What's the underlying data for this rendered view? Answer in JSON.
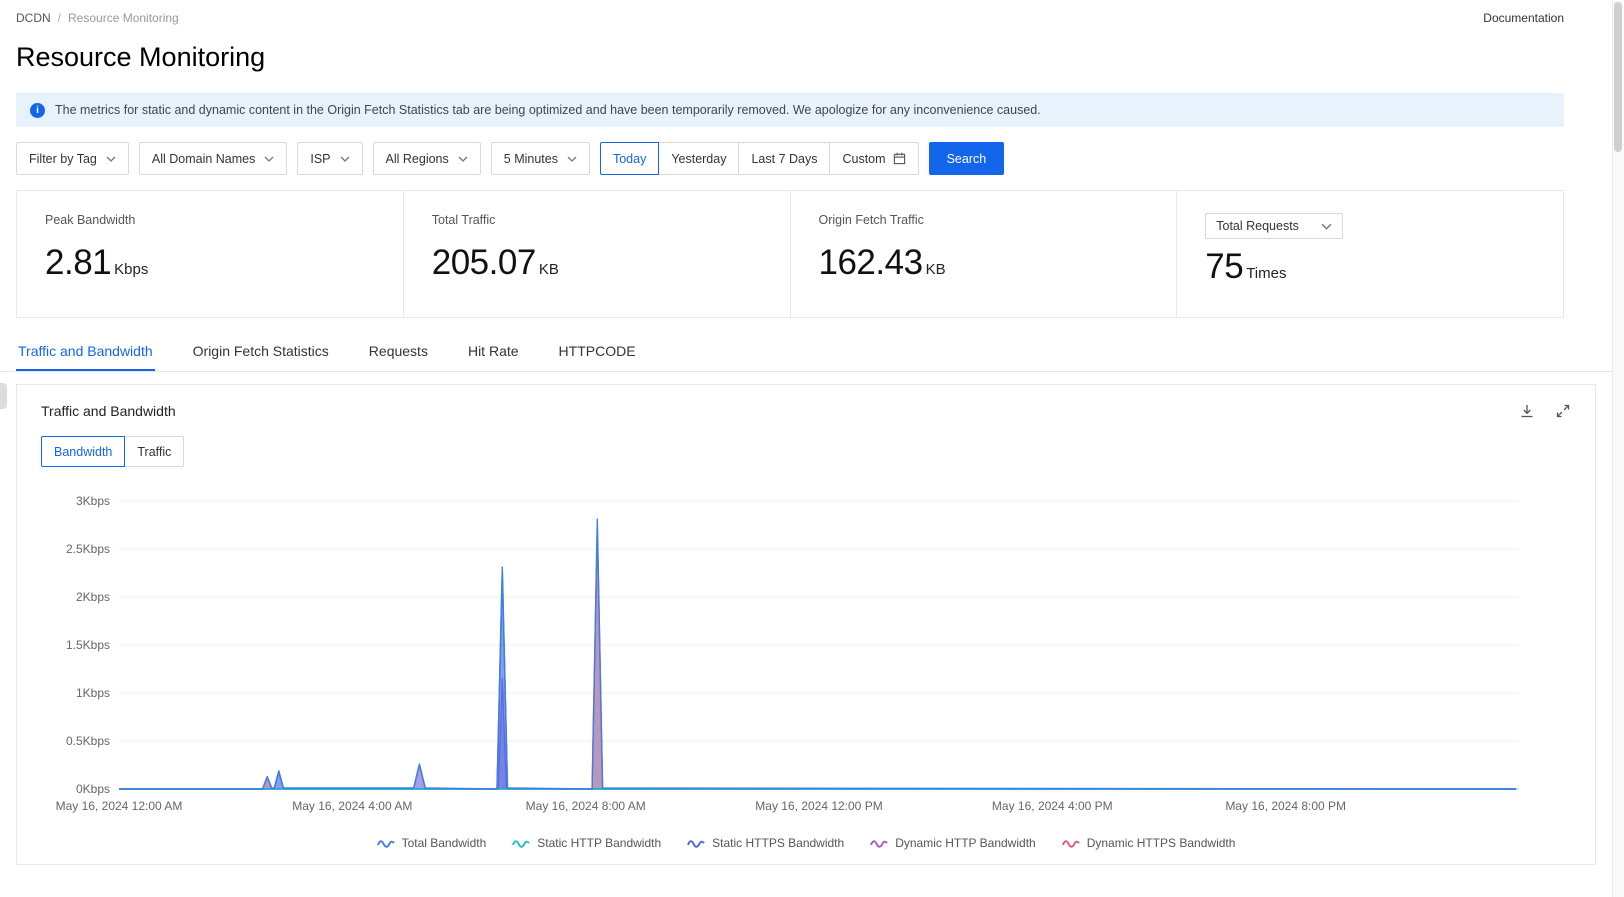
{
  "colors": {
    "accent": "#1366ec"
  },
  "breadcrumb": {
    "root": "DCDN",
    "separator": "/",
    "current": "Resource Monitoring"
  },
  "topbar": {
    "doc_link": "Documentation"
  },
  "page": {
    "title": "Resource Monitoring"
  },
  "banner": {
    "text": "The metrics for static and dynamic content in the Origin Fetch Statistics tab are being optimized and have been temporarily removed. We apologize for any inconvenience caused."
  },
  "filters": {
    "tag_label": "Filter by Tag",
    "domain_label": "All Domain Names",
    "isp_label": "ISP",
    "regions_label": "All Regions",
    "interval_label": "5 Minutes",
    "ranges": [
      "Today",
      "Yesterday",
      "Last 7 Days",
      "Custom"
    ],
    "active_range": "Today",
    "search_label": "Search"
  },
  "stats": [
    {
      "label": "Peak Bandwidth",
      "value": "2.81",
      "unit": "Kbps"
    },
    {
      "label": "Total Traffic",
      "value": "205.07",
      "unit": "KB"
    },
    {
      "label": "Origin Fetch Traffic",
      "value": "162.43",
      "unit": "KB"
    },
    {
      "label": "Total Requests",
      "value": "75",
      "unit": "Times"
    }
  ],
  "tabs": {
    "items": [
      "Traffic and Bandwidth",
      "Origin Fetch Statistics",
      "Requests",
      "Hit Rate",
      "HTTPCODE"
    ],
    "active": "Traffic and Bandwidth"
  },
  "chart_panel": {
    "title": "Traffic and Bandwidth",
    "toggles": [
      "Bandwidth",
      "Traffic"
    ],
    "active_toggle": "Bandwidth"
  },
  "chart_data": {
    "type": "area",
    "title": "Traffic and Bandwidth",
    "unit": "Kbps",
    "xlim_hours": [
      0,
      24
    ],
    "ylim_kbps": [
      0,
      3
    ],
    "grid": "horizontal",
    "legend_position": "bottom",
    "y_ticks": [
      {
        "v": 0,
        "label": "0Kbps"
      },
      {
        "v": 0.5,
        "label": "0.5Kbps"
      },
      {
        "v": 1,
        "label": "1Kbps"
      },
      {
        "v": 1.5,
        "label": "1.5Kbps"
      },
      {
        "v": 2,
        "label": "2Kbps"
      },
      {
        "v": 2.5,
        "label": "2.5Kbps"
      },
      {
        "v": 3,
        "label": "3Kbps"
      }
    ],
    "x_ticks": [
      {
        "h": 0,
        "label": "May 16, 2024 12:00 AM"
      },
      {
        "h": 4,
        "label": "May 16, 2024 4:00 AM"
      },
      {
        "h": 8,
        "label": "May 16, 2024 8:00 AM"
      },
      {
        "h": 12,
        "label": "May 16, 2024 12:00 PM"
      },
      {
        "h": 16,
        "label": "May 16, 2024 4:00 PM"
      },
      {
        "h": 20,
        "label": "May 16, 2024 8:00 PM"
      }
    ],
    "series": [
      {
        "name": "Total Bandwidth",
        "color": "#3D7FE4",
        "fill_opacity": 0.3,
        "points": [
          [
            0,
            0
          ],
          [
            2.46,
            0
          ],
          [
            2.54,
            0.13
          ],
          [
            2.62,
            0.01
          ],
          [
            2.66,
            0.01
          ],
          [
            2.74,
            0.19
          ],
          [
            2.82,
            0.01
          ],
          [
            5.05,
            0.01
          ],
          [
            5.15,
            0.26
          ],
          [
            5.25,
            0.01
          ],
          [
            6.48,
            0
          ],
          [
            6.57,
            2.31
          ],
          [
            6.66,
            0.01
          ],
          [
            8.11,
            0
          ],
          [
            8.2,
            2.81
          ],
          [
            8.29,
            0.01
          ],
          [
            23.95,
            0
          ]
        ]
      },
      {
        "name": "Static HTTP Bandwidth",
        "color": "#18C5C5",
        "fill_opacity": 0.5,
        "points": [
          [
            0,
            0
          ],
          [
            23.95,
            0
          ]
        ]
      },
      {
        "name": "Static HTTPS Bandwidth",
        "color": "#4C63E2",
        "fill_opacity": 0.5,
        "points": [
          [
            0,
            0
          ],
          [
            2.66,
            0
          ],
          [
            2.74,
            0.18
          ],
          [
            2.82,
            0
          ],
          [
            6.48,
            0
          ],
          [
            6.57,
            2.27
          ],
          [
            6.66,
            0
          ],
          [
            23.95,
            0
          ]
        ]
      },
      {
        "name": "Dynamic HTTP Bandwidth",
        "color": "#9C5FD8",
        "fill_opacity": 0.5,
        "points": [
          [
            0,
            0
          ],
          [
            5.05,
            0
          ],
          [
            5.15,
            0.25
          ],
          [
            5.25,
            0
          ],
          [
            6.5,
            0
          ],
          [
            6.57,
            1.15
          ],
          [
            6.64,
            0
          ],
          [
            23.95,
            0
          ]
        ]
      },
      {
        "name": "Dynamic HTTPS Bandwidth",
        "color": "#E2596E",
        "fill_opacity": 0.55,
        "points": [
          [
            0,
            0
          ],
          [
            2.46,
            0
          ],
          [
            2.54,
            0.12
          ],
          [
            2.62,
            0
          ],
          [
            8.11,
            0
          ],
          [
            8.2,
            2.72
          ],
          [
            8.29,
            0
          ],
          [
            23.95,
            0
          ]
        ]
      }
    ]
  }
}
